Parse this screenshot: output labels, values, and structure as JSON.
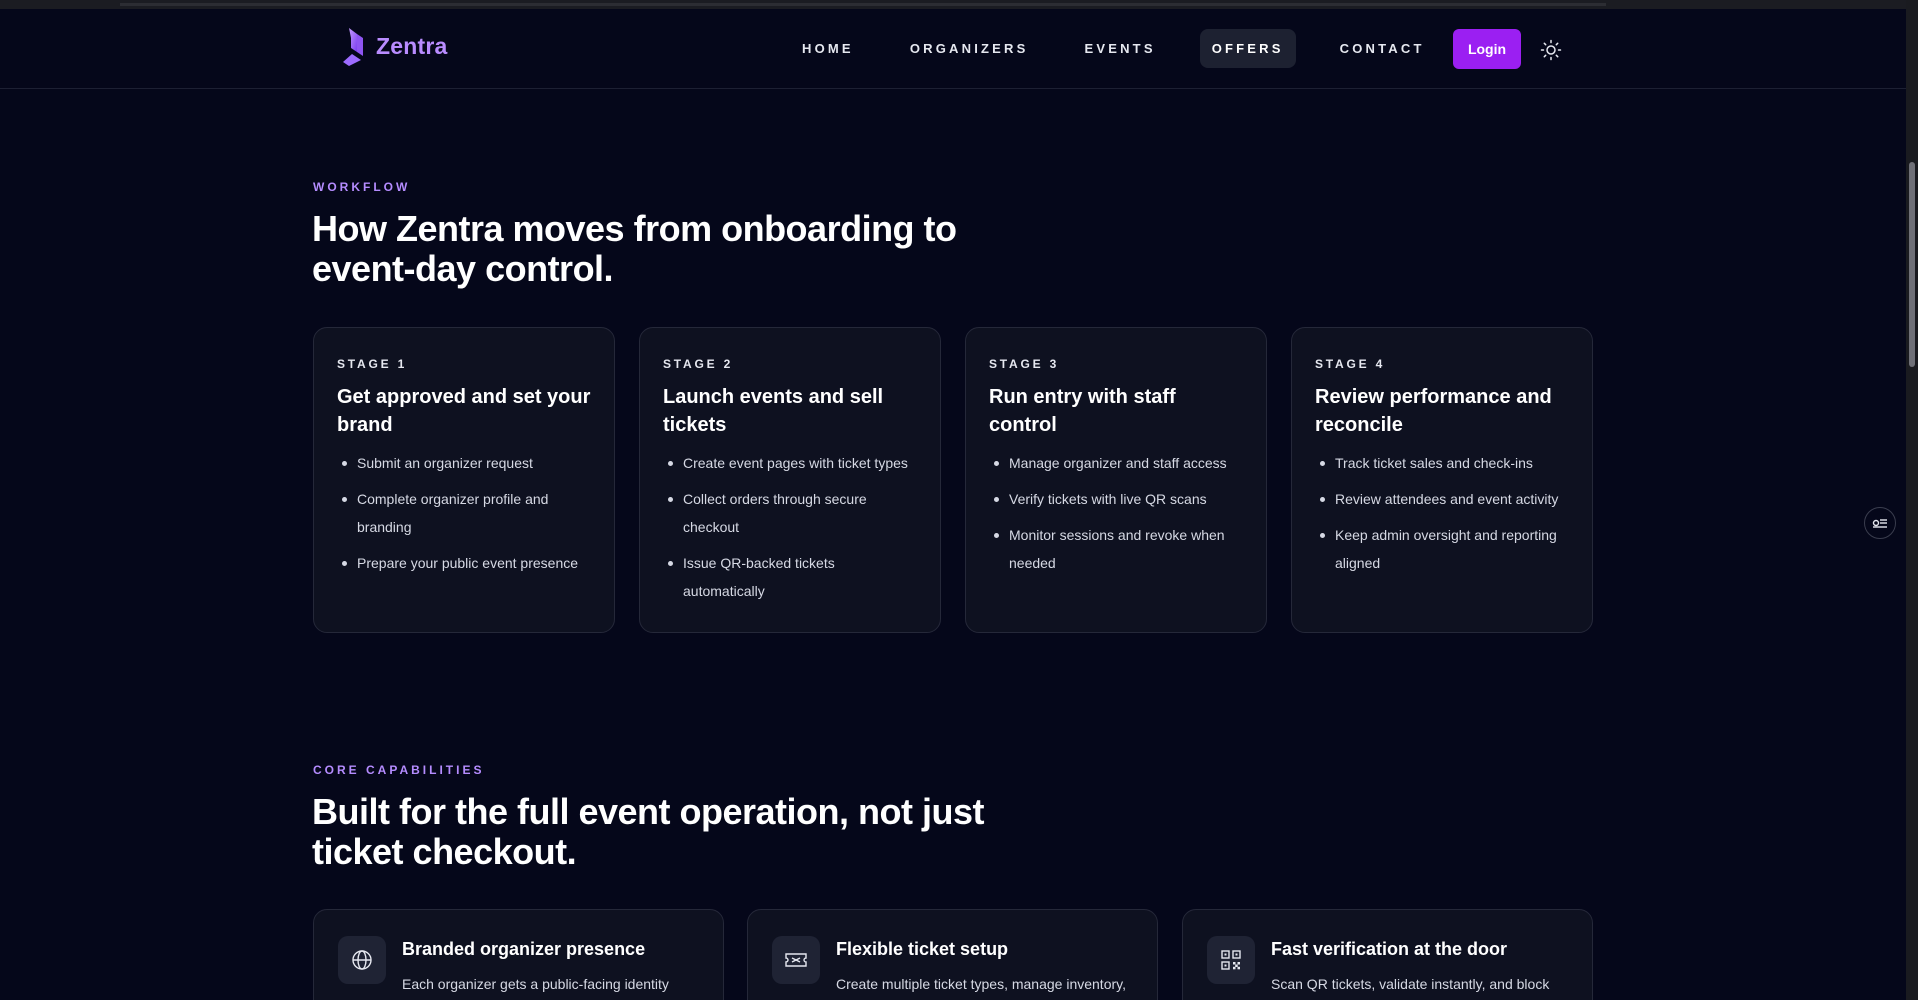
{
  "header": {
    "logo_text": "Zentra",
    "nav": [
      {
        "label": "HOME",
        "active": false
      },
      {
        "label": "ORGANIZERS",
        "active": false
      },
      {
        "label": "EVENTS",
        "active": false
      },
      {
        "label": "OFFERS",
        "active": true
      },
      {
        "label": "CONTACT",
        "active": false
      }
    ],
    "login_label": "Login",
    "theme_icon": "sun-icon"
  },
  "workflow": {
    "eyebrow": "WORKFLOW",
    "title_line1": "How Zentra moves from onboarding to",
    "title_line2": "event-day control.",
    "stages": [
      {
        "label": "STAGE 1",
        "title": "Get approved and set your brand",
        "items": [
          "Submit an organizer request",
          "Complete organizer profile and branding",
          "Prepare your public event presence"
        ]
      },
      {
        "label": "STAGE 2",
        "title": "Launch events and sell tickets",
        "items": [
          "Create event pages with ticket types",
          "Collect orders through secure checkout",
          "Issue QR-backed tickets automatically"
        ]
      },
      {
        "label": "STAGE 3",
        "title": "Run entry with staff control",
        "items": [
          "Manage organizer and staff access",
          "Verify tickets with live QR scans",
          "Monitor sessions and revoke when needed"
        ]
      },
      {
        "label": "STAGE 4",
        "title": "Review performance and reconcile",
        "items": [
          "Track ticket sales and check-ins",
          "Review attendees and event activity",
          "Keep admin oversight and reporting aligned"
        ]
      }
    ]
  },
  "capabilities": {
    "eyebrow": "CORE CAPABILITIES",
    "title_line1": "Built for the full event operation, not just",
    "title_line2": "ticket checkout.",
    "cards": [
      {
        "icon": "globe-icon",
        "title": "Branded organizer presence",
        "description": "Each organizer gets a public-facing identity"
      },
      {
        "icon": "ticket-icon",
        "title": "Flexible ticket setup",
        "description": "Create multiple ticket types, manage inventory,"
      },
      {
        "icon": "qr-code-icon",
        "title": "Fast verification at the door",
        "description": "Scan QR tickets, validate instantly, and block"
      }
    ]
  },
  "colors": {
    "background": "#05071a",
    "accent": "#9b1ff2",
    "eyebrow": "#b58cff",
    "card": "#0e1120"
  }
}
